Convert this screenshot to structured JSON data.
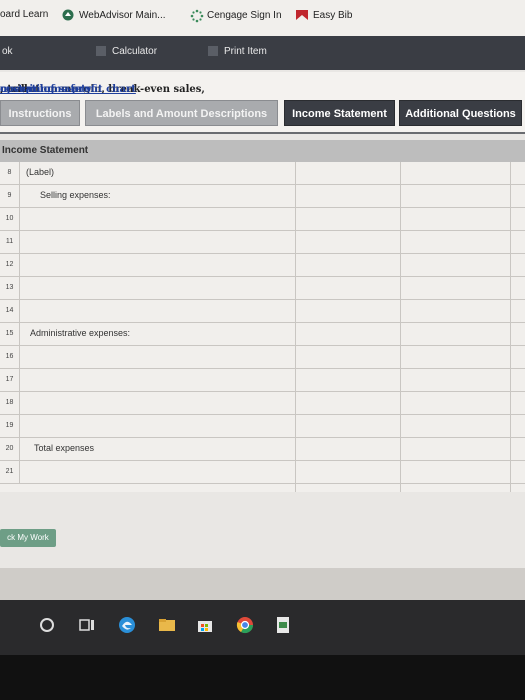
{
  "bookmarks": [
    {
      "label": "oard Learn",
      "icon": "none"
    },
    {
      "label": "WebAdvisor Main...",
      "icon": "webadvisor-icon"
    },
    {
      "label": "Cengage Sign In",
      "icon": "cengage-icon"
    },
    {
      "label": "Easy Bib",
      "icon": "easybib-icon"
    }
  ],
  "app_header": {
    "left_text": "ok",
    "calculator_label": "Calculator",
    "print_label": "Print Item"
  },
  "topic": {
    "prefix": "ntribution margin, break-even sales, ",
    "link1": "cost-volume-profit chart",
    "sep1": ", ",
    "link2": "margin of safety",
    "sep2": ", and ",
    "link3": "operating"
  },
  "tabs": [
    {
      "label": "Instructions",
      "active": false
    },
    {
      "label": "Labels and Amount Descriptions",
      "active": false
    },
    {
      "label": "Income Statement",
      "active": true
    },
    {
      "label": "Additional Questions",
      "active": false
    }
  ],
  "worksheet": {
    "title": "Income Statement",
    "rows": [
      {
        "num": "8",
        "label": "(Label)"
      },
      {
        "num": "9",
        "label": "Selling expenses:"
      },
      {
        "num": "10",
        "label": ""
      },
      {
        "num": "11",
        "label": ""
      },
      {
        "num": "12",
        "label": ""
      },
      {
        "num": "13",
        "label": ""
      },
      {
        "num": "14",
        "label": ""
      },
      {
        "num": "15",
        "label": "Administrative expenses:"
      },
      {
        "num": "16",
        "label": ""
      },
      {
        "num": "17",
        "label": ""
      },
      {
        "num": "18",
        "label": ""
      },
      {
        "num": "19",
        "label": ""
      },
      {
        "num": "20",
        "label": "Total expenses"
      },
      {
        "num": "21",
        "label": ""
      }
    ]
  },
  "check_button": "ck My Work",
  "colors": {
    "active_tab": "#3a3d44",
    "inactive_tab": "#a9abae",
    "link": "#1f3f9c",
    "check_button": "#6e9e86"
  }
}
